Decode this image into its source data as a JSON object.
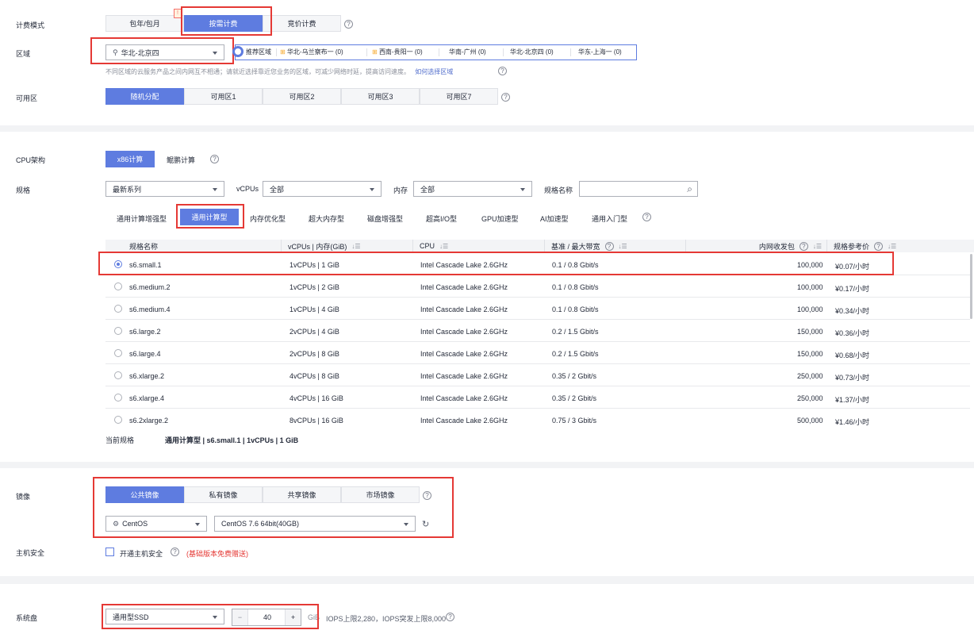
{
  "billing": {
    "label": "计费模式",
    "options": [
      "包年/包月",
      "按需计费",
      "竞价计费"
    ],
    "active": "按需计费",
    "badge": "!"
  },
  "region": {
    "label": "区域",
    "selected": "华北-北京四",
    "recommend_label": "推荐区域",
    "recommend": [
      {
        "name": "华北-乌兰察布一",
        "count": "(0)"
      },
      {
        "name": "西南-贵阳一",
        "count": "(0)"
      },
      {
        "name": "华南-广州",
        "count": "(0)"
      },
      {
        "name": "华北-北京四",
        "count": "(0)"
      },
      {
        "name": "华东-上海一",
        "count": "(0)"
      }
    ],
    "hint": "不同区域的云服务产品之间内网互不相通；请就近选择靠近您业务的区域，可减少网络时延，提高访问速度。",
    "hint_link": "如何选择区域"
  },
  "az": {
    "label": "可用区",
    "options": [
      "随机分配",
      "可用区1",
      "可用区2",
      "可用区3",
      "可用区7"
    ]
  },
  "cpu_arch": {
    "label": "CPU架构",
    "options": [
      "x86计算",
      "鲲鹏计算"
    ]
  },
  "spec": {
    "label": "规格",
    "series": "最新系列",
    "vcpus_label": "vCPUs",
    "vcpus_value": "全部",
    "mem_label": "内存",
    "mem_value": "全部",
    "name_label": "规格名称",
    "tabs": [
      "通用计算增强型",
      "通用计算型",
      "内存优化型",
      "超大内存型",
      "磁盘增强型",
      "超高I/O型",
      "GPU加速型",
      "AI加速型",
      "通用入门型"
    ],
    "active_tab": "通用计算型",
    "columns": [
      "规格名称",
      "vCPUs | 内存(GiB)",
      "CPU",
      "基准 / 最大带宽",
      "内网收发包",
      "规格参考价"
    ],
    "rows": [
      {
        "name": "s6.small.1",
        "vcpu_mem": "1vCPUs | 1 GiB",
        "cpu": "Intel Cascade Lake 2.6GHz",
        "bw": "0.1 / 0.8 Gbit/s",
        "pps": "100,000",
        "price": "¥0.07/小时"
      },
      {
        "name": "s6.medium.2",
        "vcpu_mem": "1vCPUs | 2 GiB",
        "cpu": "Intel Cascade Lake 2.6GHz",
        "bw": "0.1 / 0.8 Gbit/s",
        "pps": "100,000",
        "price": "¥0.17/小时"
      },
      {
        "name": "s6.medium.4",
        "vcpu_mem": "1vCPUs | 4 GiB",
        "cpu": "Intel Cascade Lake 2.6GHz",
        "bw": "0.1 / 0.8 Gbit/s",
        "pps": "100,000",
        "price": "¥0.34/小时"
      },
      {
        "name": "s6.large.2",
        "vcpu_mem": "2vCPUs | 4 GiB",
        "cpu": "Intel Cascade Lake 2.6GHz",
        "bw": "0.2 / 1.5 Gbit/s",
        "pps": "150,000",
        "price": "¥0.36/小时"
      },
      {
        "name": "s6.large.4",
        "vcpu_mem": "2vCPUs | 8 GiB",
        "cpu": "Intel Cascade Lake 2.6GHz",
        "bw": "0.2 / 1.5 Gbit/s",
        "pps": "150,000",
        "price": "¥0.68/小时"
      },
      {
        "name": "s6.xlarge.2",
        "vcpu_mem": "4vCPUs | 8 GiB",
        "cpu": "Intel Cascade Lake 2.6GHz",
        "bw": "0.35 / 2 Gbit/s",
        "pps": "250,000",
        "price": "¥0.73/小时"
      },
      {
        "name": "s6.xlarge.4",
        "vcpu_mem": "4vCPUs | 16 GiB",
        "cpu": "Intel Cascade Lake 2.6GHz",
        "bw": "0.35 / 2 Gbit/s",
        "pps": "250,000",
        "price": "¥1.37/小时"
      },
      {
        "name": "s6.2xlarge.2",
        "vcpu_mem": "8vCPUs | 16 GiB",
        "cpu": "Intel Cascade Lake 2.6GHz",
        "bw": "0.75 / 3 Gbit/s",
        "pps": "500,000",
        "price": "¥1.46/小时"
      }
    ],
    "current_label": "当前规格",
    "current_value": "通用计算型 | s6.small.1 | 1vCPUs | 1 GiB"
  },
  "image": {
    "label": "镜像",
    "tabs": [
      "公共镜像",
      "私有镜像",
      "共享镜像",
      "市场镜像"
    ],
    "os": "CentOS",
    "version": "CentOS 7.6 64bit(40GB)"
  },
  "host_security": {
    "label": "主机安全",
    "checkbox": "开通主机安全",
    "note": "(基础版本免费赠送)"
  },
  "system_disk": {
    "label": "系统盘",
    "type": "通用型SSD",
    "size": "40",
    "unit": "GiB",
    "iops": "IOPS上限2,280，IOPS突发上限8,000",
    "minus": "−",
    "plus": "+"
  },
  "colors": {
    "accent": "#5e7ce0",
    "highlight": "#e53935"
  }
}
